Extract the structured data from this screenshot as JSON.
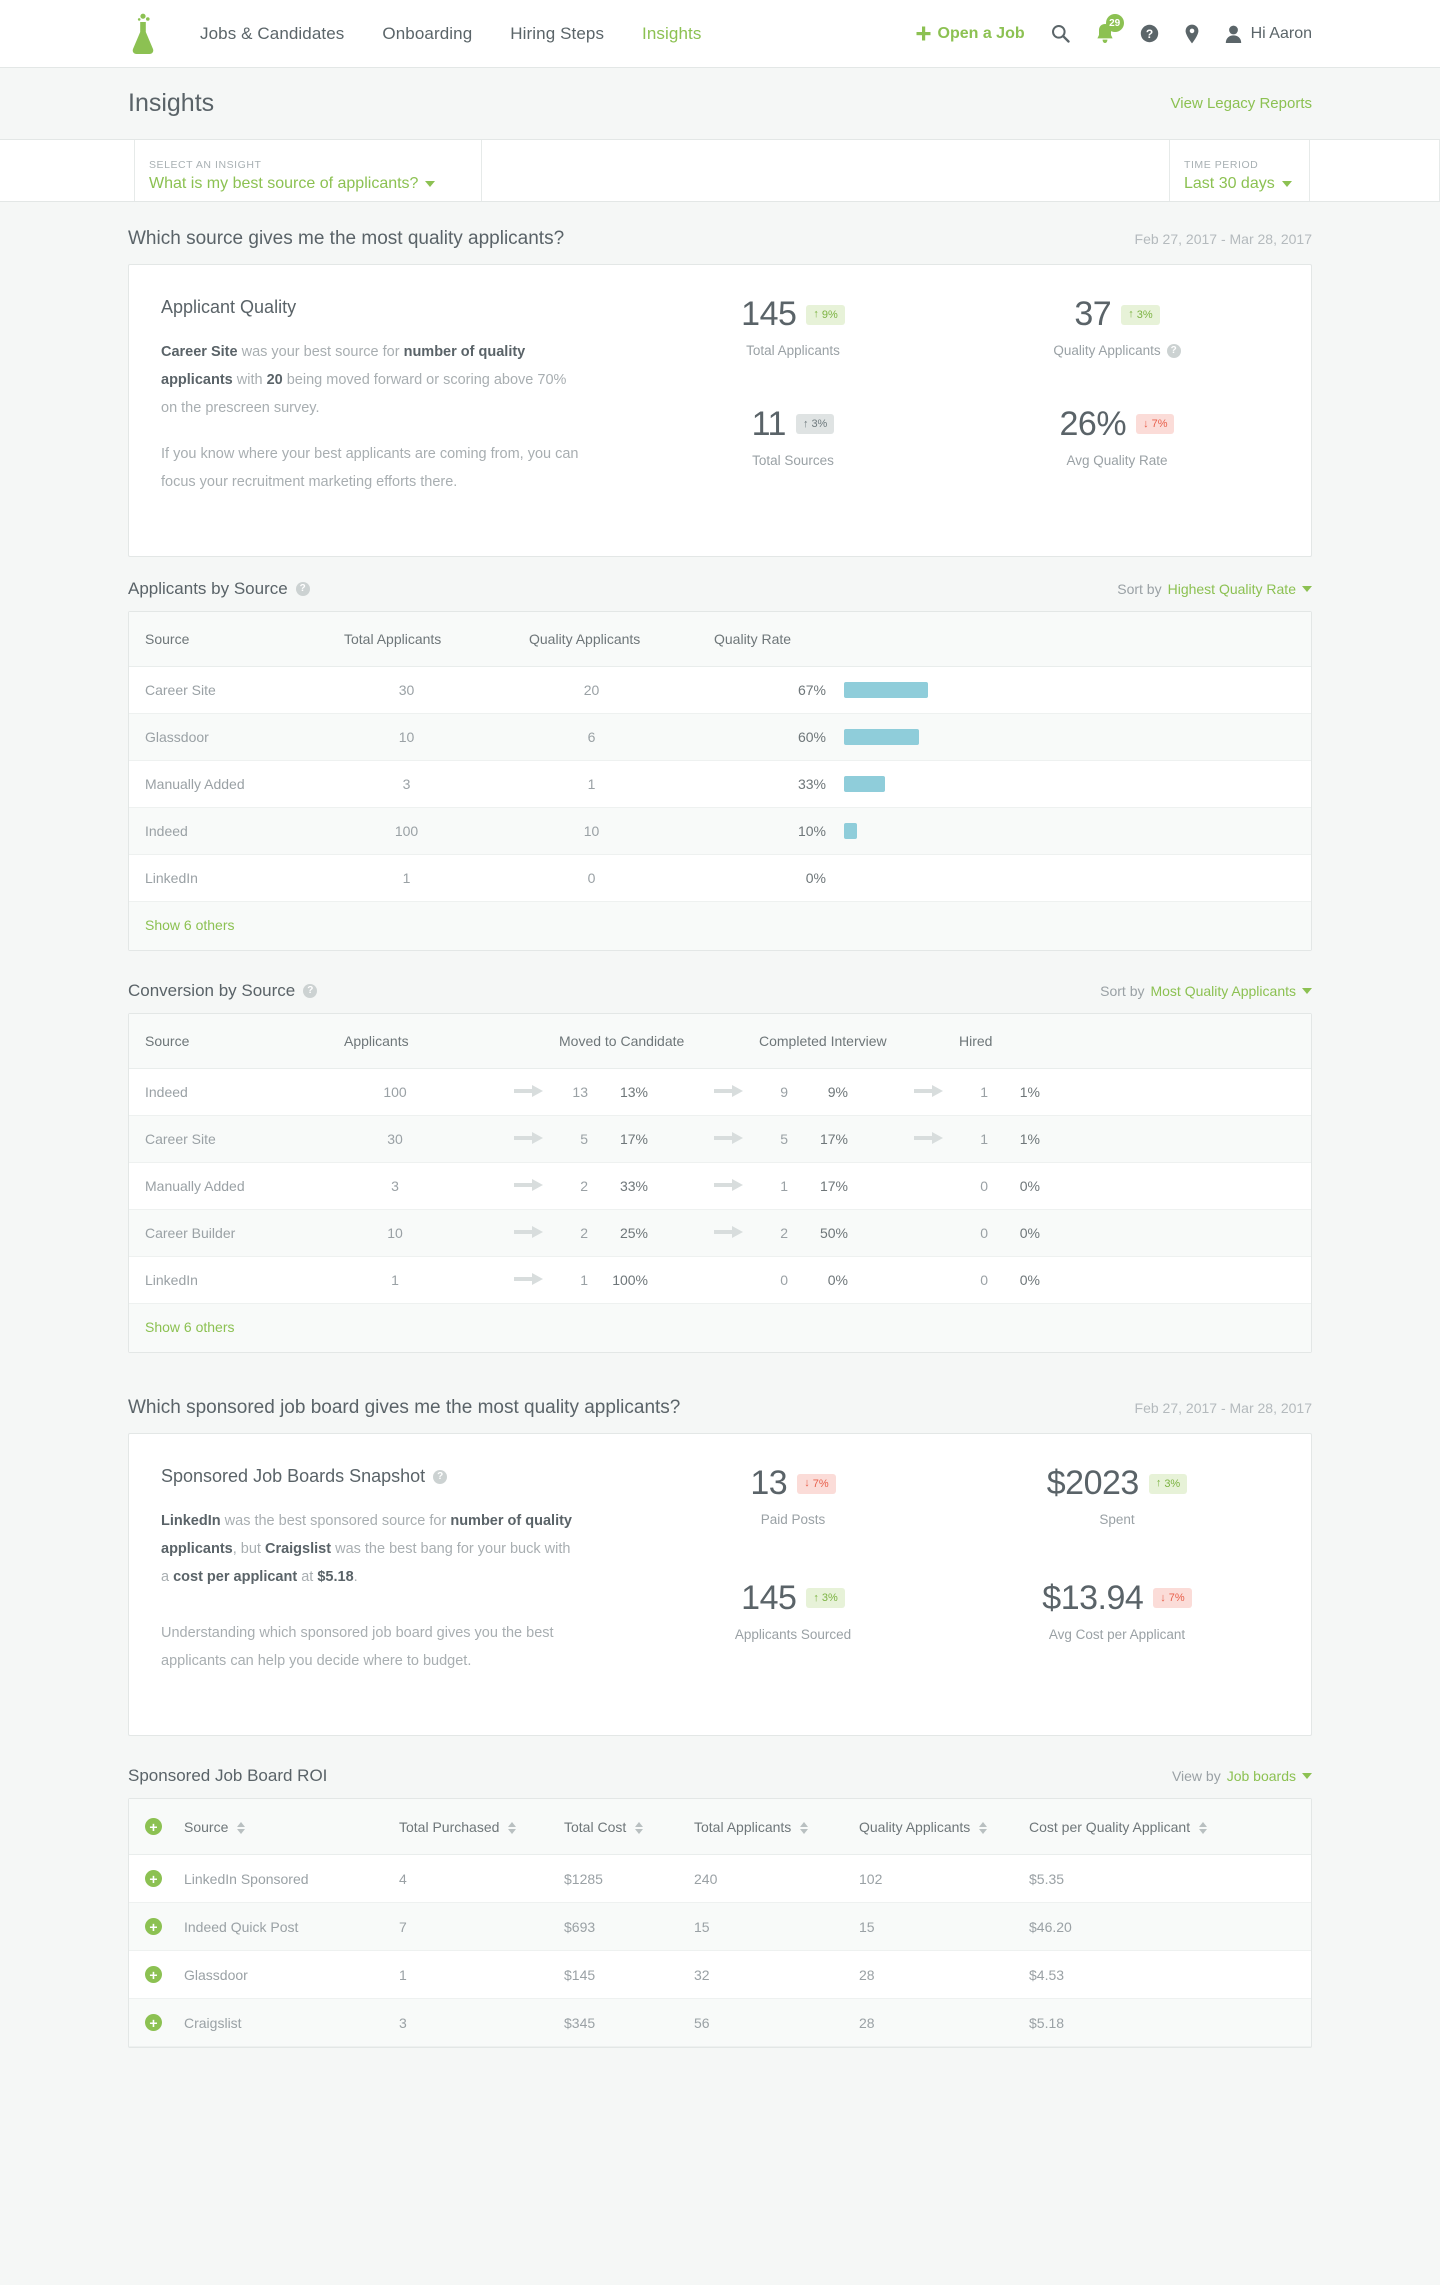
{
  "nav": {
    "logo_icon": "flask-logo",
    "links": [
      {
        "label": "Jobs & Candidates",
        "active": false
      },
      {
        "label": "Onboarding",
        "active": false
      },
      {
        "label": "Hiring Steps",
        "active": false
      },
      {
        "label": "Insights",
        "active": true
      }
    ],
    "open_job": "Open a Job",
    "search_icon": "search-icon",
    "notification_icon": "bell-icon",
    "notification_count": "29",
    "help_icon": "question-circle-icon",
    "location_icon": "map-pin-icon",
    "user_icon": "person-icon",
    "greeting": "Hi Aaron"
  },
  "header": {
    "title": "Insights",
    "legacy_link": "View Legacy Reports"
  },
  "filterbar": {
    "insight_label": "SELECT AN INSIGHT",
    "insight_value": "What is my best source of applicants?",
    "period_label": "TIME PERIOD",
    "period_value": "Last 30 days"
  },
  "section1": {
    "question": "Which source gives me the most quality applicants?",
    "date_range": "Feb 27, 2017 - Mar 28, 2017",
    "card_title": "Applicant Quality",
    "paragraph1_a": "Career Site",
    "paragraph1_b": " was your best source for ",
    "paragraph1_c": "number of quality applicants",
    "paragraph1_d": " with ",
    "paragraph1_e": "20",
    "paragraph1_f": " being moved forward or scoring above 70% on the prescreen survey.",
    "paragraph2": "If you know where your best applicants are coming from, you can focus your recruitment marketing efforts there.",
    "stats": [
      {
        "value": "145",
        "delta": "9%",
        "dir": "up",
        "tone": "up",
        "label": "Total Applicants",
        "has_help": false
      },
      {
        "value": "37",
        "delta": "3%",
        "dir": "up",
        "tone": "up",
        "label": "Quality Applicants",
        "has_help": true
      },
      {
        "value": "11",
        "delta": "3%",
        "dir": "up",
        "tone": "flat",
        "label": "Total Sources",
        "has_help": false
      },
      {
        "value": "26%",
        "delta": "7%",
        "dir": "down",
        "tone": "down",
        "label": "Avg Quality Rate",
        "has_help": false
      }
    ]
  },
  "applicants_by_source": {
    "title": "Applicants by Source",
    "sort_prefix": "Sort by",
    "sort_value": "Highest Quality Rate",
    "columns": [
      "Source",
      "Total Applicants",
      "Quality Applicants",
      "Quality Rate",
      ""
    ],
    "rows": [
      {
        "source": "Career Site",
        "total": "30",
        "quality": "20",
        "rate": "67%",
        "bar_pct": 67
      },
      {
        "source": "Glassdoor",
        "total": "10",
        "quality": "6",
        "rate": "60%",
        "bar_pct": 60
      },
      {
        "source": "Manually Added",
        "total": "3",
        "quality": "1",
        "rate": "33%",
        "bar_pct": 33
      },
      {
        "source": "Indeed",
        "total": "100",
        "quality": "10",
        "rate": "10%",
        "bar_pct": 10
      },
      {
        "source": "LinkedIn",
        "total": "1",
        "quality": "0",
        "rate": "0%",
        "bar_pct": 0
      }
    ],
    "show_more": "Show 6 others"
  },
  "conversion_by_source": {
    "title": "Conversion by Source",
    "sort_prefix": "Sort by",
    "sort_value": "Most Quality Applicants",
    "columns": [
      "Source",
      "Applicants",
      "Moved to Candidate",
      "Completed Interview",
      "Hired"
    ],
    "rows": [
      {
        "source": "Indeed",
        "applicants": "100",
        "moved_n": "13",
        "moved_p": "13%",
        "interview_n": "9",
        "interview_p": "9%",
        "hired_n": "1",
        "hired_p": "1%",
        "arrow3": true
      },
      {
        "source": "Career Site",
        "applicants": "30",
        "moved_n": "5",
        "moved_p": "17%",
        "interview_n": "5",
        "interview_p": "17%",
        "hired_n": "1",
        "hired_p": "1%",
        "arrow3": true
      },
      {
        "source": "Manually Added",
        "applicants": "3",
        "moved_n": "2",
        "moved_p": "33%",
        "interview_n": "1",
        "interview_p": "17%",
        "hired_n": "0",
        "hired_p": "0%",
        "arrow3": false
      },
      {
        "source": "Career Builder",
        "applicants": "10",
        "moved_n": "2",
        "moved_p": "25%",
        "interview_n": "2",
        "interview_p": "50%",
        "hired_n": "0",
        "hired_p": "0%",
        "arrow3": false
      },
      {
        "source": "LinkedIn",
        "applicants": "1",
        "moved_n": "1",
        "moved_p": "100%",
        "interview_n": "0",
        "interview_p": "0%",
        "hired_n": "0",
        "hired_p": "0%",
        "arrow2": false,
        "arrow3": false
      }
    ],
    "show_more": "Show 6 others"
  },
  "section2": {
    "question": "Which sponsored job board gives me the most quality applicants?",
    "date_range": "Feb 27, 2017 - Mar 28, 2017",
    "card_title": "Sponsored Job Boards Snapshot",
    "paragraph1_a": "LinkedIn",
    "paragraph1_b": " was the best sponsored source for ",
    "paragraph1_c": "number of quality applicants",
    "paragraph1_d": ", but ",
    "paragraph1_e": "Craigslist",
    "paragraph1_f": " was the best bang for your buck with a ",
    "paragraph1_g": "cost per applicant",
    "paragraph1_h": " at ",
    "paragraph1_i": "$5.18",
    "paragraph1_j": ".",
    "paragraph2": "Understanding which sponsored job board gives you the best applicants can help you decide where to budget.",
    "stats": [
      {
        "value": "13",
        "delta": "7%",
        "dir": "down",
        "tone": "down",
        "label": "Paid Posts",
        "has_help": false
      },
      {
        "value": "$2023",
        "delta": "3%",
        "dir": "up",
        "tone": "up",
        "label": "Spent",
        "has_help": false
      },
      {
        "value": "145",
        "delta": "3%",
        "dir": "up",
        "tone": "up",
        "label": "Applicants Sourced",
        "has_help": false
      },
      {
        "value": "$13.94",
        "delta": "7%",
        "dir": "down",
        "tone": "down",
        "label": "Avg Cost per Applicant",
        "has_help": false
      }
    ]
  },
  "roi": {
    "title": "Sponsored Job Board ROI",
    "viewby_prefix": "View by",
    "viewby_value": "Job boards",
    "columns": [
      "Source",
      "Total Purchased",
      "Total Cost",
      "Total Applicants",
      "Quality Applicants",
      "Cost per Quality Applicant"
    ],
    "rows": [
      {
        "source": "LinkedIn Sponsored",
        "purchased": "4",
        "cost": "$1285",
        "total_applicants": "240",
        "quality_applicants": "102",
        "cpqa": "$5.35"
      },
      {
        "source": "Indeed Quick Post",
        "purchased": "7",
        "cost": "$693",
        "total_applicants": "15",
        "quality_applicants": "15",
        "cpqa": "$46.20"
      },
      {
        "source": "Glassdoor",
        "purchased": "1",
        "cost": "$145",
        "total_applicants": "32",
        "quality_applicants": "28",
        "cpqa": "$4.53"
      },
      {
        "source": "Craigslist",
        "purchased": "3",
        "cost": "$345",
        "total_applicants": "56",
        "quality_applicants": "28",
        "cpqa": "$5.18"
      }
    ],
    "expand_icon": "plus-circle-icon"
  },
  "colors": {
    "accent_green": "#8cc152",
    "bar_blue": "#8fcdda",
    "up_bg": "#e7f2d8",
    "down_bg": "#fbdcd8",
    "flat_bg": "#dfe3e3",
    "text": "#5a6368"
  }
}
